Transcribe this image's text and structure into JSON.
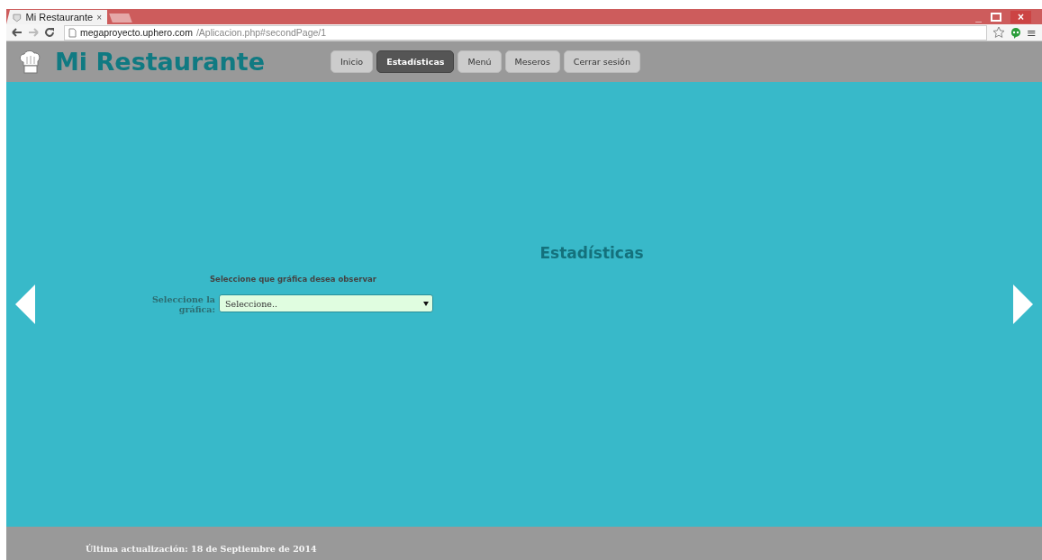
{
  "browser": {
    "tab_title": "Mi Restaurante",
    "tab_close": "×",
    "url_host": "megaproyecto.uphero.com",
    "url_path": "/Aplicacion.php#secondPage/1",
    "window_controls": [
      "_",
      "×"
    ],
    "menu_glyph": "≡"
  },
  "header": {
    "title": "Mi Restaurante"
  },
  "nav": [
    {
      "label": "Inicio",
      "selected": false
    },
    {
      "label": "Estadísticas",
      "selected": true
    },
    {
      "label": "Menú",
      "selected": false
    },
    {
      "label": "Meseros",
      "selected": false
    },
    {
      "label": "Cerrar sesión",
      "selected": false
    }
  ],
  "section": {
    "heading": "Estadísticas",
    "prompt": "Seleccione que gráfica desea observar",
    "field_label": "Seleccione la gráfica:",
    "select_value": "Seleccione.."
  },
  "footer": {
    "text": "Última actualización: 18 de Septiembre de 2014"
  }
}
